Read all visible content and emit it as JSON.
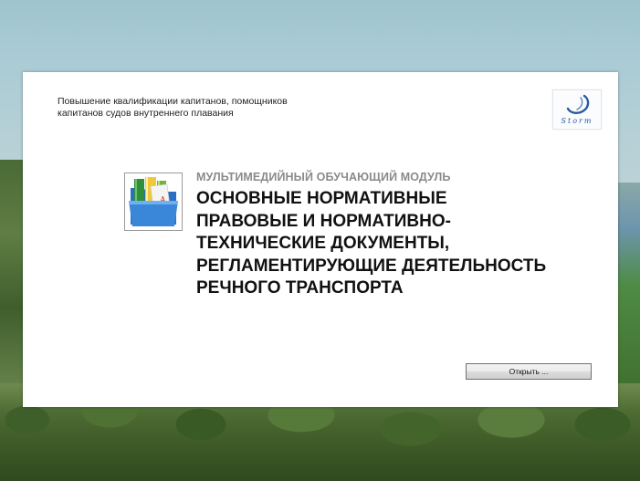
{
  "window": {
    "subtitle_line1": "Повышение квалификации капитанов, помощников",
    "subtitle_line2": "капитанов судов внутреннего плавания"
  },
  "logo": {
    "text": "Storm",
    "icon": "storm-logo-icon"
  },
  "module": {
    "icon": "books-folder-icon",
    "label": "МУЛЬТИМЕДИЙНЫЙ ОБУЧАЮЩИЙ МОДУЛЬ",
    "title_lines": [
      "ОСНОВНЫЕ НОРМАТИВНЫЕ",
      "ПРАВОВЫЕ И НОРМАТИВНО-",
      "ТЕХНИЧЕСКИЕ ДОКУМЕНТЫ,",
      "РЕГЛАМЕНТИРУЮЩИЕ ДЕЯТЕЛЬНОСТЬ",
      "РЕЧНОГО ТРАНСПОРТА"
    ]
  },
  "actions": {
    "open_label": "Открыть ..."
  },
  "colors": {
    "label_gray": "#8a8a8a",
    "title_black": "#111111",
    "logo_blue": "#2a5a9e"
  }
}
